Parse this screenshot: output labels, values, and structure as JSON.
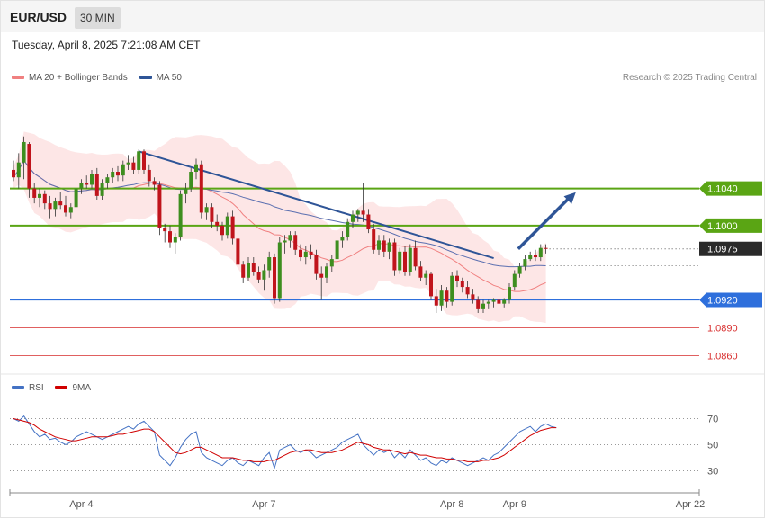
{
  "header": {
    "symbol": "EUR/USD",
    "timeframe": "30 MIN",
    "datetime": "Tuesday, April 8, 2025 7:21:08 AM CET",
    "credit": "Research © 2025 Trading Central"
  },
  "legend": {
    "bb_label": "MA 20 + Bollinger Bands",
    "bb_color": "#f08080",
    "ma50_label": "MA 50",
    "ma50_color": "#2f5597"
  },
  "rsi_legend": {
    "rsi_label": "RSI",
    "rsi_color": "#4472c4",
    "ma_label": "9MA",
    "ma_color": "#d00000"
  },
  "chart_data": [
    {
      "type": "candlestick",
      "ylim": [
        1.0845,
        1.115
      ],
      "x_ticks": [
        {
          "index": 13,
          "label": "Apr 4"
        },
        {
          "index": 48,
          "label": "Apr 7"
        },
        {
          "index": 84,
          "label": "Apr 8"
        },
        {
          "index": 96,
          "label": "Apr 9"
        },
        {
          "index": 105,
          "label": "Apr 22"
        }
      ],
      "levels": [
        {
          "value": 1.104,
          "label": "1.1040",
          "kind": "resistance"
        },
        {
          "value": 1.1,
          "label": "1.1000",
          "kind": "resistance"
        },
        {
          "value": 1.0975,
          "label": "1.0975",
          "kind": "last"
        },
        {
          "value": 1.092,
          "label": "1.0920",
          "kind": "support"
        },
        {
          "value": 1.089,
          "label": "1.0890",
          "kind": "support-minor"
        },
        {
          "value": 1.086,
          "label": "1.0860",
          "kind": "support-minor"
        }
      ],
      "colors": {
        "up": "#3e8e1f",
        "down": "#c0141c",
        "resistance": "#5aa514",
        "support": "#2e6fdc",
        "support_minor": "#d83030",
        "last": "#2a2a2a",
        "arrow": "#2f5597",
        "trendline": "#2f5597"
      },
      "trendline": [
        {
          "x": 24,
          "y": 1.108
        },
        {
          "x": 92,
          "y": 1.0965
        }
      ],
      "arrow": [
        {
          "x": 96,
          "y": 1.0975
        },
        {
          "x": 106,
          "y": 1.1036
        }
      ],
      "candles": [
        [
          1.106,
          1.107,
          1.1048,
          1.1052
        ],
        [
          1.1052,
          1.1078,
          1.104,
          1.1068
        ],
        [
          1.1068,
          1.1096,
          1.105,
          1.109
        ],
        [
          1.1088,
          1.109,
          1.103,
          1.104
        ],
        [
          1.104,
          1.1046,
          1.1024,
          1.103
        ],
        [
          1.103,
          1.104,
          1.102,
          1.1034
        ],
        [
          1.1034,
          1.1038,
          1.1018,
          1.1024
        ],
        [
          1.1024,
          1.1032,
          1.1008,
          1.1018
        ],
        [
          1.1018,
          1.103,
          1.101,
          1.1026
        ],
        [
          1.1026,
          1.1036,
          1.1018,
          1.1022
        ],
        [
          1.1022,
          1.1032,
          1.101,
          1.1014
        ],
        [
          1.1014,
          1.1024,
          1.1008,
          1.102
        ],
        [
          1.102,
          1.1044,
          1.1016,
          1.104
        ],
        [
          1.104,
          1.105,
          1.1034,
          1.1046
        ],
        [
          1.1046,
          1.1054,
          1.104,
          1.1044
        ],
        [
          1.1044,
          1.106,
          1.104,
          1.1056
        ],
        [
          1.1056,
          1.1062,
          1.1028,
          1.1032
        ],
        [
          1.1032,
          1.105,
          1.1028,
          1.1046
        ],
        [
          1.1046,
          1.1056,
          1.104,
          1.1052
        ],
        [
          1.1052,
          1.1062,
          1.1046,
          1.1058
        ],
        [
          1.1058,
          1.1064,
          1.1048,
          1.1054
        ],
        [
          1.1054,
          1.107,
          1.1048,
          1.1066
        ],
        [
          1.1066,
          1.1076,
          1.106,
          1.1068
        ],
        [
          1.1068,
          1.1074,
          1.1056,
          1.106
        ],
        [
          1.106,
          1.1082,
          1.1056,
          1.108
        ],
        [
          1.108,
          1.1082,
          1.1056,
          1.106
        ],
        [
          1.106,
          1.1066,
          1.1042,
          1.1048
        ],
        [
          1.1048,
          1.1052,
          1.1038,
          1.1044
        ],
        [
          1.1044,
          1.1048,
          1.099,
          1.0998
        ],
        [
          1.0998,
          1.1002,
          1.0982,
          1.0994
        ],
        [
          1.0994,
          1.1,
          1.0976,
          1.0982
        ],
        [
          1.0982,
          1.0992,
          1.097,
          1.0988
        ],
        [
          1.0988,
          1.1038,
          1.0984,
          1.1034
        ],
        [
          1.1034,
          1.1046,
          1.1024,
          1.104
        ],
        [
          1.104,
          1.1062,
          1.1036,
          1.1058
        ],
        [
          1.1058,
          1.1072,
          1.105,
          1.1066
        ],
        [
          1.1066,
          1.107,
          1.1008,
          1.1014
        ],
        [
          1.1014,
          1.1024,
          1.1006,
          1.102
        ],
        [
          1.102,
          1.1024,
          1.0998,
          1.1004
        ],
        [
          1.1004,
          1.1012,
          1.0994,
          1.1
        ],
        [
          1.1,
          1.1004,
          1.0984,
          1.099
        ],
        [
          1.099,
          1.1014,
          1.0986,
          1.101
        ],
        [
          1.101,
          1.1016,
          1.098,
          1.0986
        ],
        [
          1.0986,
          1.099,
          1.095,
          1.0958
        ],
        [
          1.0958,
          1.0962,
          1.0938,
          1.0944
        ],
        [
          1.0944,
          1.0966,
          1.094,
          1.096
        ],
        [
          1.096,
          1.0966,
          1.0946,
          1.095
        ],
        [
          1.095,
          1.0956,
          1.0938,
          1.0942
        ],
        [
          1.0942,
          1.0958,
          1.093,
          1.0952
        ],
        [
          1.0952,
          1.0972,
          1.0944,
          1.0966
        ],
        [
          1.0966,
          1.097,
          1.0916,
          1.0922
        ],
        [
          1.0922,
          1.0988,
          1.0918,
          1.0982
        ],
        [
          1.0982,
          1.099,
          1.097,
          1.0984
        ],
        [
          1.0984,
          1.0994,
          1.0976,
          1.099
        ],
        [
          1.099,
          1.0994,
          1.0968,
          1.0974
        ],
        [
          1.0974,
          1.098,
          1.0962,
          1.0966
        ],
        [
          1.0966,
          1.0978,
          1.0958,
          1.0972
        ],
        [
          1.0972,
          1.098,
          1.0964,
          1.0968
        ],
        [
          1.0968,
          1.0974,
          1.0942,
          1.0948
        ],
        [
          1.0948,
          1.0956,
          1.092,
          1.0944
        ],
        [
          1.0944,
          1.096,
          1.0938,
          1.0956
        ],
        [
          1.0956,
          1.0968,
          1.095,
          1.0964
        ],
        [
          1.0964,
          1.0988,
          1.096,
          1.0984
        ],
        [
          1.0984,
          1.0994,
          1.0976,
          1.0988
        ],
        [
          1.0988,
          1.1008,
          1.0984,
          1.1004
        ],
        [
          1.1004,
          1.1016,
          1.0998,
          1.1012
        ],
        [
          1.1012,
          1.1018,
          1.1004,
          1.1016
        ],
        [
          1.1016,
          1.1046,
          1.1004,
          1.1012
        ],
        [
          1.1012,
          1.1018,
          1.0992,
          1.0996
        ],
        [
          1.0996,
          1.1002,
          1.097,
          1.0974
        ],
        [
          1.0974,
          1.099,
          1.0968,
          1.0984
        ],
        [
          1.0984,
          1.099,
          1.0966,
          1.0972
        ],
        [
          1.0972,
          1.0986,
          1.0964,
          1.0982
        ],
        [
          1.0982,
          1.0986,
          1.0946,
          1.0952
        ],
        [
          1.0952,
          1.0976,
          1.0948,
          1.0972
        ],
        [
          1.0972,
          1.0978,
          1.0946,
          1.095
        ],
        [
          1.095,
          1.098,
          1.0946,
          1.0976
        ],
        [
          1.0976,
          1.0984,
          1.0952,
          1.0956
        ],
        [
          1.0956,
          1.0962,
          1.094,
          1.0944
        ],
        [
          1.0944,
          1.0952,
          1.0936,
          1.0948
        ],
        [
          1.0948,
          1.095,
          1.092,
          1.0924
        ],
        [
          1.0924,
          1.0932,
          1.0906,
          1.0914
        ],
        [
          1.0914,
          1.0936,
          1.0908,
          1.093
        ],
        [
          1.093,
          1.0934,
          1.0912,
          1.0918
        ],
        [
          1.0918,
          1.095,
          1.0914,
          1.0946
        ],
        [
          1.0946,
          1.0952,
          1.0934,
          1.094
        ],
        [
          1.094,
          1.0944,
          1.0928,
          1.0934
        ],
        [
          1.0934,
          1.094,
          1.0922,
          1.0926
        ],
        [
          1.0926,
          1.0932,
          1.0916,
          1.092
        ],
        [
          1.092,
          1.0924,
          1.0906,
          1.091
        ],
        [
          1.091,
          1.092,
          1.0906,
          1.0916
        ],
        [
          1.0916,
          1.092,
          1.091,
          1.0918
        ],
        [
          1.0918,
          1.0922,
          1.0912,
          1.092
        ],
        [
          1.092,
          1.0924,
          1.0912,
          1.0916
        ],
        [
          1.0916,
          1.0922,
          1.0912,
          1.092
        ],
        [
          1.092,
          1.0938,
          1.0916,
          1.0934
        ],
        [
          1.0934,
          1.0952,
          1.093,
          1.0948
        ],
        [
          1.0948,
          1.096,
          1.0944,
          1.0956
        ],
        [
          1.0956,
          1.0968,
          1.0952,
          1.0964
        ],
        [
          1.0964,
          1.0972,
          1.0962,
          1.0968
        ],
        [
          1.0968,
          1.0974,
          1.0962,
          1.0966
        ],
        [
          1.0966,
          1.098,
          1.0962,
          1.0976
        ],
        [
          1.0976,
          1.098,
          1.097,
          1.0975
        ]
      ]
    },
    {
      "type": "line",
      "name": "RSI",
      "ylim": [
        20,
        80
      ],
      "levels": [
        70,
        50,
        30
      ],
      "series": [
        {
          "name": "RSI",
          "color": "#4472c4"
        },
        {
          "name": "9MA",
          "color": "#d00000"
        }
      ],
      "rsi_values": [
        70,
        68,
        72,
        66,
        60,
        56,
        58,
        54,
        55,
        52,
        50,
        52,
        56,
        58,
        60,
        58,
        56,
        54,
        56,
        58,
        60,
        62,
        64,
        62,
        66,
        68,
        64,
        60,
        42,
        38,
        34,
        40,
        48,
        54,
        58,
        60,
        44,
        40,
        38,
        36,
        34,
        38,
        40,
        36,
        34,
        38,
        36,
        34,
        40,
        44,
        32,
        46,
        48,
        50,
        46,
        44,
        46,
        44,
        40,
        42,
        44,
        46,
        48,
        52,
        54,
        56,
        58,
        50,
        46,
        42,
        46,
        44,
        46,
        40,
        44,
        40,
        46,
        42,
        38,
        40,
        36,
        34,
        38,
        36,
        40,
        38,
        36,
        34,
        36,
        38,
        40,
        38,
        42,
        44,
        48,
        52,
        56,
        60,
        62,
        64,
        60,
        64,
        66,
        64,
        63
      ],
      "ma_values": [
        70,
        69,
        68,
        67,
        65,
        62,
        60,
        58,
        56,
        55,
        54,
        53,
        53,
        54,
        55,
        56,
        56,
        56,
        56,
        57,
        58,
        58,
        59,
        60,
        61,
        62,
        62,
        60,
        56,
        52,
        48,
        44,
        43,
        44,
        46,
        48,
        48,
        46,
        44,
        42,
        40,
        40,
        40,
        39,
        38,
        38,
        37,
        37,
        37,
        38,
        38,
        40,
        42,
        44,
        45,
        45,
        46,
        46,
        45,
        44,
        44,
        44,
        45,
        46,
        48,
        50,
        52,
        51,
        50,
        48,
        47,
        46,
        46,
        45,
        44,
        43,
        44,
        43,
        42,
        42,
        41,
        40,
        40,
        39,
        39,
        38,
        38,
        37,
        37,
        37,
        38,
        38,
        39,
        40,
        42,
        45,
        48,
        51,
        54,
        57,
        59,
        61,
        62,
        63,
        63
      ]
    }
  ]
}
